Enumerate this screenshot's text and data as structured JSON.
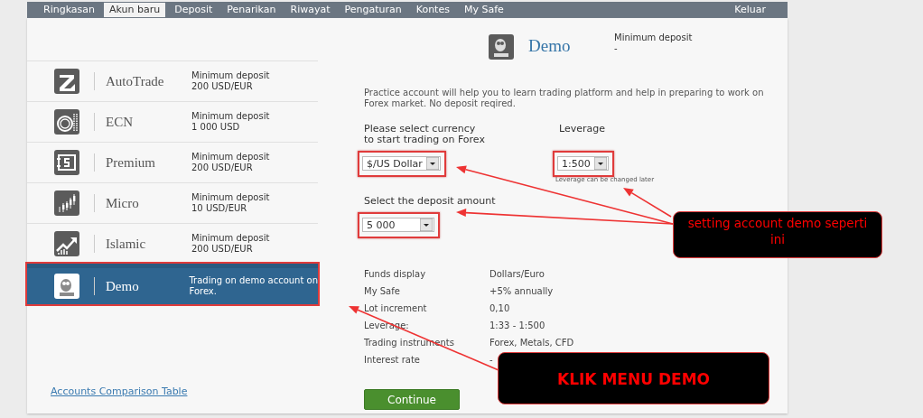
{
  "nav": {
    "items": [
      {
        "label": "Ringkasan",
        "selected": false
      },
      {
        "label": "Akun baru",
        "selected": true
      },
      {
        "label": "Deposit",
        "selected": false
      },
      {
        "label": "Penarikan",
        "selected": false
      },
      {
        "label": "Riwayat",
        "selected": false
      },
      {
        "label": "Pengaturan",
        "selected": false
      },
      {
        "label": "Kontes",
        "selected": false
      },
      {
        "label": "My Safe",
        "selected": false
      }
    ],
    "logout": "Keluar"
  },
  "accounts": [
    {
      "kind": "arrow",
      "name": "AutoTrade",
      "description": "Minimum deposit\n200 USD/EUR",
      "selected": false,
      "highlighted": false
    },
    {
      "kind": "coin",
      "name": "ECN",
      "description": "Minimum deposit\n1 000 USD",
      "selected": false,
      "highlighted": false
    },
    {
      "kind": "banknote",
      "name": "Premium",
      "description": "Minimum deposit\n200 USD/EUR",
      "selected": false,
      "highlighted": false
    },
    {
      "kind": "candles",
      "name": "Micro",
      "description": "Minimum deposit\n10 USD/EUR",
      "selected": false,
      "highlighted": false
    },
    {
      "kind": "growth",
      "name": "Islamic",
      "description": "Minimum deposit\n200 USD/EUR",
      "selected": false,
      "highlighted": false
    },
    {
      "kind": "owl",
      "name": "Demo",
      "description": "Trading on demo account on\nForex.",
      "selected": true,
      "highlighted": true
    }
  ],
  "comparison_link": "Accounts Comparison Table",
  "detail": {
    "title": "Demo",
    "min_deposit_label": "Minimum deposit",
    "min_deposit_value": "-",
    "description": "Practice account will help you to learn trading platform and help in preparing to work on Forex market. No deposit reqired.",
    "currency": {
      "label": "Please select currency\nto start trading on Forex",
      "value": "$/US Dollar",
      "highlighted": true
    },
    "leverage": {
      "label": "Leverage",
      "value": "1:500",
      "hint": "Leverage can be changed later",
      "highlighted": true
    },
    "deposit": {
      "label": "Select the deposit amount",
      "value": "5 000",
      "highlighted": true
    },
    "info": [
      {
        "label": "Funds display",
        "value": "Dollars/Euro"
      },
      {
        "label": "My Safe",
        "value": "+5% annually"
      },
      {
        "label": "Lot increment",
        "value": "0,10"
      },
      {
        "label": "Leverage:",
        "value": "1:33 - 1:500"
      },
      {
        "label": "Trading instruments",
        "value": "Forex, Metals, CFD"
      },
      {
        "label": "Interest rate",
        "value": "-"
      }
    ],
    "continue_button": "Continue"
  },
  "annotations": [
    {
      "kind": "note",
      "text": "setting account demo seperti ini"
    },
    {
      "kind": "headline",
      "text": "KLIK MENU DEMO"
    }
  ]
}
